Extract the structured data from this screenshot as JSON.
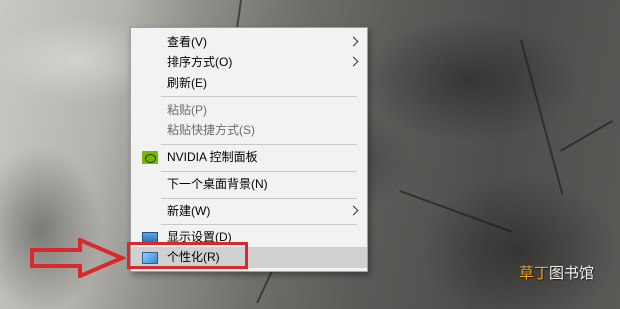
{
  "menu": {
    "items": [
      {
        "label": "查看(V)",
        "submenu": true,
        "disabled": false
      },
      {
        "label": "排序方式(O)",
        "submenu": true,
        "disabled": false
      },
      {
        "label": "刷新(E)",
        "submenu": false,
        "disabled": false
      },
      {
        "label": "粘贴(P)",
        "submenu": false,
        "disabled": true
      },
      {
        "label": "粘贴快捷方式(S)",
        "submenu": false,
        "disabled": true
      },
      {
        "label": "NVIDIA 控制面板",
        "submenu": false,
        "disabled": false,
        "icon": "nvidia-icon"
      },
      {
        "label": "下一个桌面背景(N)",
        "submenu": false,
        "disabled": false
      },
      {
        "label": "新建(W)",
        "submenu": true,
        "disabled": false
      },
      {
        "label": "显示设置(D)",
        "submenu": false,
        "disabled": false,
        "icon": "display-settings-icon"
      },
      {
        "label": "个性化(R)",
        "submenu": false,
        "disabled": false,
        "icon": "personalize-icon",
        "highlighted": true
      }
    ]
  },
  "annotation": {
    "highlight_color": "#d82a2a",
    "arrow_color": "#d82a2a"
  },
  "watermark": {
    "accent": "草丁",
    "rest": "图书馆",
    "accent_color": "#f1a21a"
  }
}
